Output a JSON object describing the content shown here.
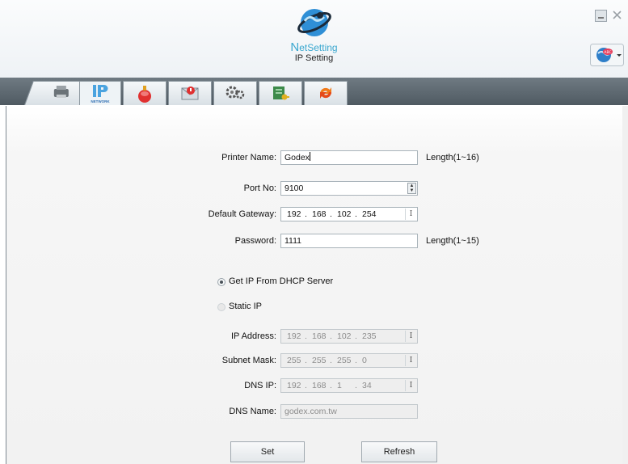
{
  "header": {
    "app_name": "NetSetting",
    "app_name_initial": "N",
    "app_name_rest": "etSetting",
    "subtitle": "IP Setting",
    "minimize_icon": "minimize-icon",
    "close_icon": "close-icon",
    "language_icon": "language-globe-icon",
    "language_badge": "ABC"
  },
  "tabs": [
    {
      "icon": "printer-tab-icon"
    },
    {
      "icon": "ip-network-tab-icon",
      "sub": "NETWORK",
      "active": true
    },
    {
      "icon": "alert-bell-tab-icon"
    },
    {
      "icon": "email-alert-tab-icon"
    },
    {
      "icon": "settings-gears-tab-icon"
    },
    {
      "icon": "key-document-tab-icon"
    },
    {
      "icon": "refresh-arrows-tab-icon"
    }
  ],
  "form": {
    "printer_name": {
      "label": "Printer Name:",
      "value": "Godex",
      "hint": "Length(1~16)"
    },
    "port_no": {
      "label": "Port No:",
      "value": "9100"
    },
    "default_gateway": {
      "label": "Default Gateway:",
      "octets": [
        "192",
        "168",
        "102",
        "254"
      ]
    },
    "password": {
      "label": "Password:",
      "value": "1111",
      "hint": "Length(1~15)"
    },
    "dhcp": {
      "label": "Get IP From DHCP Server",
      "selected": true
    },
    "static": {
      "label": "Static IP",
      "selected": false
    },
    "ip_address": {
      "label": "IP Address:",
      "octets": [
        "192",
        "168",
        "102",
        "235"
      ]
    },
    "subnet_mask": {
      "label": "Subnet Mask:",
      "octets": [
        "255",
        "255",
        "255",
        "0"
      ]
    },
    "dns_ip": {
      "label": "DNS IP:",
      "octets": [
        "192",
        "168",
        "1",
        "34"
      ]
    },
    "dns_name": {
      "label": "DNS Name:",
      "value": "godex.com.tw"
    }
  },
  "buttons": {
    "set": "Set",
    "refresh": "Refresh"
  },
  "colors": {
    "accent": "#3aa7cf",
    "tabstrip": "#5b666e",
    "disabled_text": "#8c8c8c"
  }
}
